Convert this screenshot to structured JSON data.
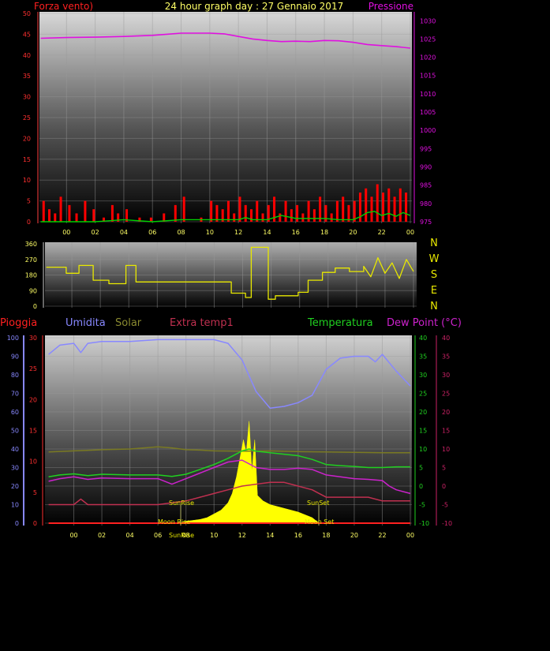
{
  "header": {
    "left_label": "Forza vento)",
    "title": "24 hour graph day : 27 Gennaio 2017",
    "right_label": "Pressione"
  },
  "colors": {
    "wind": "#ff0000",
    "gust_line": "#00d000",
    "pressure": "#e010e0",
    "direction": "#e8e800",
    "humidity": "#8888ff",
    "solar": "#7a7a22",
    "extra_temp": "#c03050",
    "temperature": "#20d020",
    "dew_point": "#cc22cc",
    "rain": "#ff2020",
    "sun_area": "#ffff00",
    "axis_text": "#ffff66"
  },
  "direction_labels": [
    "N",
    "W",
    "S",
    "E",
    "N"
  ],
  "legend": {
    "rain": "Pioggia",
    "humidity": "Umidita",
    "solar": "Solar",
    "extra_temp": "Extra temp1",
    "temperature": "Temperatura",
    "dew_point": "Dew Point (°C)"
  },
  "annotations": {
    "sunrise": "SunRise",
    "sunset": "SunSet",
    "moonrise": "Moon Rise",
    "moonset": "Moon Set",
    "sunrise_bottom": "SunRise"
  },
  "chart_data": [
    {
      "type": "line",
      "x_ticks": [
        "00",
        "02",
        "04",
        "06",
        "08",
        "10",
        "12",
        "14",
        "16",
        "18",
        "20",
        "22",
        "00"
      ],
      "left_axis": {
        "ticks": [
          "0",
          "5",
          "10",
          "15",
          "20",
          "25",
          "30",
          "35",
          "40",
          "45",
          "50"
        ],
        "ylim": [
          0,
          50
        ]
      },
      "right_axis": {
        "ticks": [
          "975",
          "980",
          "985",
          "990",
          "995",
          "1000",
          "1005",
          "1010",
          "1015",
          "1020",
          "1025",
          "1030"
        ],
        "ylim": [
          975,
          1032
        ]
      },
      "series": [
        {
          "name": "Pressione",
          "axis": "right",
          "x": [
            -1.8,
            0,
            2,
            4,
            6,
            7,
            8,
            9,
            10,
            11,
            12,
            13,
            14,
            15,
            16,
            17,
            18,
            19,
            20,
            21,
            22,
            23,
            24
          ],
          "values": [
            1025.2,
            1025.4,
            1025.5,
            1025.7,
            1026.0,
            1026.3,
            1026.6,
            1026.6,
            1026.6,
            1026.4,
            1025.7,
            1025.0,
            1024.6,
            1024.3,
            1024.4,
            1024.3,
            1024.6,
            1024.5,
            1024.1,
            1023.5,
            1023.2,
            1022.9,
            1022.5
          ]
        },
        {
          "name": "Gust",
          "axis": "left",
          "x": [
            -1.8,
            0,
            2,
            4,
            6,
            8,
            10,
            11,
            12,
            12.5,
            13,
            14,
            15,
            16,
            17,
            18,
            19,
            20,
            20.5,
            21,
            21.5,
            22,
            22.5,
            23,
            23.5,
            24
          ],
          "values": [
            0,
            0,
            0,
            0.5,
            0,
            0.5,
            0.5,
            0.5,
            0.5,
            1,
            0.5,
            0.5,
            1.5,
            0.8,
            0.8,
            0.8,
            0.5,
            0.5,
            1.2,
            2.2,
            2.5,
            1.5,
            2,
            1.3,
            2.2,
            1.5
          ]
        }
      ],
      "wind_bars": {
        "name": "Forza vento",
        "x": [
          -1.6,
          -1.2,
          -0.8,
          -0.4,
          0.2,
          0.7,
          1.3,
          1.9,
          2.6,
          3.2,
          3.6,
          4.2,
          5.1,
          5.9,
          6.8,
          7.6,
          8.2,
          9.4,
          10.1,
          10.5,
          10.9,
          11.3,
          11.7,
          12.1,
          12.5,
          12.9,
          13.3,
          13.7,
          14.1,
          14.5,
          14.9,
          15.3,
          15.7,
          16.1,
          16.5,
          16.9,
          17.3,
          17.7,
          18.1,
          18.5,
          18.9,
          19.3,
          19.7,
          20.1,
          20.5,
          20.9,
          21.3,
          21.7,
          22.1,
          22.5,
          22.9,
          23.3,
          23.7
        ],
        "values": [
          5,
          3,
          2,
          6,
          4,
          2,
          5,
          3,
          1,
          4,
          2,
          3,
          1,
          1,
          2,
          4,
          6,
          1,
          5,
          4,
          3,
          5,
          2,
          6,
          4,
          3,
          5,
          2,
          4,
          6,
          2,
          5,
          3,
          4,
          2,
          5,
          3,
          6,
          4,
          2,
          5,
          6,
          4,
          5,
          7,
          8,
          6,
          9,
          7,
          8,
          6,
          8,
          7
        ]
      }
    },
    {
      "type": "line",
      "name": "wind direction",
      "ticks": [
        "360",
        "270",
        "180",
        "90",
        "0"
      ],
      "ylim": [
        0,
        360
      ],
      "x": [
        -1.8,
        -0.4,
        -0.4,
        0.5,
        0.5,
        1.5,
        1.5,
        2.6,
        2.6,
        3.8,
        3.8,
        4.5,
        4.5,
        11.2,
        11.2,
        12.2,
        12.2,
        12.6,
        12.6,
        13.8,
        13.8,
        14.3,
        14.3,
        15.9,
        15.9,
        16.6,
        16.6,
        17.6,
        17.6,
        18.5,
        18.5,
        19.5,
        19.5,
        20.5,
        20.5,
        21.0,
        21.5,
        22.0,
        22.5,
        23.0,
        23.5,
        24.0
      ],
      "values": [
        225,
        225,
        190,
        190,
        235,
        235,
        150,
        150,
        130,
        130,
        235,
        235,
        140,
        140,
        75,
        75,
        50,
        50,
        340,
        340,
        40,
        40,
        60,
        60,
        80,
        80,
        150,
        150,
        195,
        195,
        220,
        220,
        200,
        200,
        230,
        170,
        280,
        190,
        250,
        160,
        270,
        200
      ]
    },
    {
      "type": "line",
      "x_ticks": [
        "00",
        "02",
        "04",
        "06",
        "08",
        "10",
        "12",
        "14",
        "16",
        "18",
        "20",
        "22",
        "00"
      ],
      "axes": {
        "humidity": {
          "ticks": [
            "0",
            "10",
            "20",
            "30",
            "40",
            "50",
            "60",
            "70",
            "80",
            "90",
            "100"
          ],
          "ylim": [
            0,
            100
          ]
        },
        "rain": {
          "ticks": [
            "0",
            "5",
            "10",
            "15",
            "20",
            "25",
            "30"
          ],
          "ylim": [
            0,
            30
          ]
        },
        "temperature": {
          "ticks": [
            "-10",
            "-5",
            "0",
            "5",
            "10",
            "15",
            "20",
            "25",
            "30",
            "35",
            "40"
          ],
          "ylim": [
            -10,
            40
          ]
        },
        "dew_point": {
          "ticks": [
            "-10",
            "-5",
            "0",
            "5",
            "10",
            "15",
            "20",
            "25",
            "30",
            "35",
            "40"
          ],
          "ylim": [
            -10,
            40
          ]
        }
      },
      "series": [
        {
          "name": "Umidita",
          "axis": "humidity",
          "x": [
            -1.8,
            -1,
            0,
            0.5,
            1,
            2,
            4,
            6,
            8,
            9,
            10,
            11,
            12,
            13,
            14,
            15,
            16,
            17,
            18,
            19,
            20,
            21,
            21.5,
            22,
            23,
            24
          ],
          "values": [
            91,
            96,
            97,
            92,
            97,
            98,
            98,
            99,
            99,
            99,
            99,
            97,
            88,
            71,
            62,
            63,
            65,
            69,
            83,
            89,
            90,
            90,
            87,
            91,
            82,
            74
          ]
        },
        {
          "name": "Solar",
          "axis": "temperature",
          "x": [
            -1.8,
            0,
            2,
            4,
            6,
            7,
            8,
            9,
            10,
            12,
            14,
            16,
            18,
            20,
            22,
            24
          ],
          "values": [
            9.2,
            9.5,
            9.8,
            10.0,
            10.6,
            10.3,
            9.8,
            9.7,
            9.5,
            9.4,
            9.5,
            9.3,
            9.2,
            9.1,
            9.0,
            9.0
          ]
        },
        {
          "name": "Extra temp1",
          "axis": "temperature",
          "x": [
            -1.8,
            0,
            0.5,
            1,
            2,
            4,
            6,
            8,
            9,
            10,
            11,
            12,
            13,
            14,
            15,
            16,
            17,
            17.5,
            18,
            19,
            20,
            21,
            22,
            24
          ],
          "values": [
            -5,
            -5,
            -3.5,
            -5,
            -5,
            -5,
            -5,
            -4,
            -3,
            -2,
            -1,
            0,
            0.5,
            1,
            1,
            0,
            -1,
            -2,
            -3,
            -3,
            -3,
            -3,
            -4,
            -4
          ]
        },
        {
          "name": "Temperatura",
          "axis": "temperature",
          "x": [
            -1.8,
            -1,
            0,
            1,
            2,
            4,
            6,
            7,
            8,
            9,
            10,
            11,
            12,
            12.5,
            13,
            14,
            15,
            16,
            17,
            18,
            19,
            20,
            21,
            22,
            23,
            24
          ],
          "values": [
            2.5,
            3.0,
            3.3,
            2.8,
            3.2,
            3.0,
            3.0,
            2.6,
            3.2,
            4.5,
            5.8,
            7.5,
            9.5,
            10.0,
            9.4,
            9.0,
            8.6,
            8.2,
            7.2,
            5.8,
            5.5,
            5.3,
            5.0,
            5.0,
            5.2,
            5.2
          ]
        },
        {
          "name": "Dew Point",
          "axis": "temperature",
          "x": [
            -1.8,
            -1,
            0,
            1,
            2,
            4,
            6,
            7,
            8,
            9,
            10,
            11,
            12,
            13,
            14,
            15,
            16,
            17,
            18,
            19,
            20,
            21,
            22,
            22.5,
            23,
            24
          ],
          "values": [
            1.3,
            2.0,
            2.5,
            1.8,
            2.2,
            2.0,
            2.0,
            0.5,
            2.0,
            3.5,
            5.0,
            6.5,
            7.0,
            5.0,
            4.5,
            4.5,
            4.8,
            4.5,
            3.0,
            2.5,
            2.0,
            1.8,
            1.5,
            0,
            -1.0,
            -2.0
          ]
        }
      ],
      "solar_area": {
        "name": "Solar radiation",
        "x": [
          7.5,
          8,
          9,
          9.5,
          10,
          10.5,
          11,
          11.3,
          11.6,
          11.9,
          12.1,
          12.3,
          12.5,
          12.7,
          12.9,
          13.1,
          13.5,
          14,
          15,
          16,
          17,
          17.5
        ],
        "values": [
          0,
          1,
          2,
          3,
          5,
          7,
          11,
          16,
          25,
          37,
          45,
          38,
          55,
          28,
          45,
          15,
          12,
          10,
          8,
          6,
          3,
          0
        ]
      },
      "rain": {
        "name": "Pioggia",
        "x": [
          -1.8,
          24
        ],
        "values": [
          0,
          0
        ]
      }
    }
  ]
}
